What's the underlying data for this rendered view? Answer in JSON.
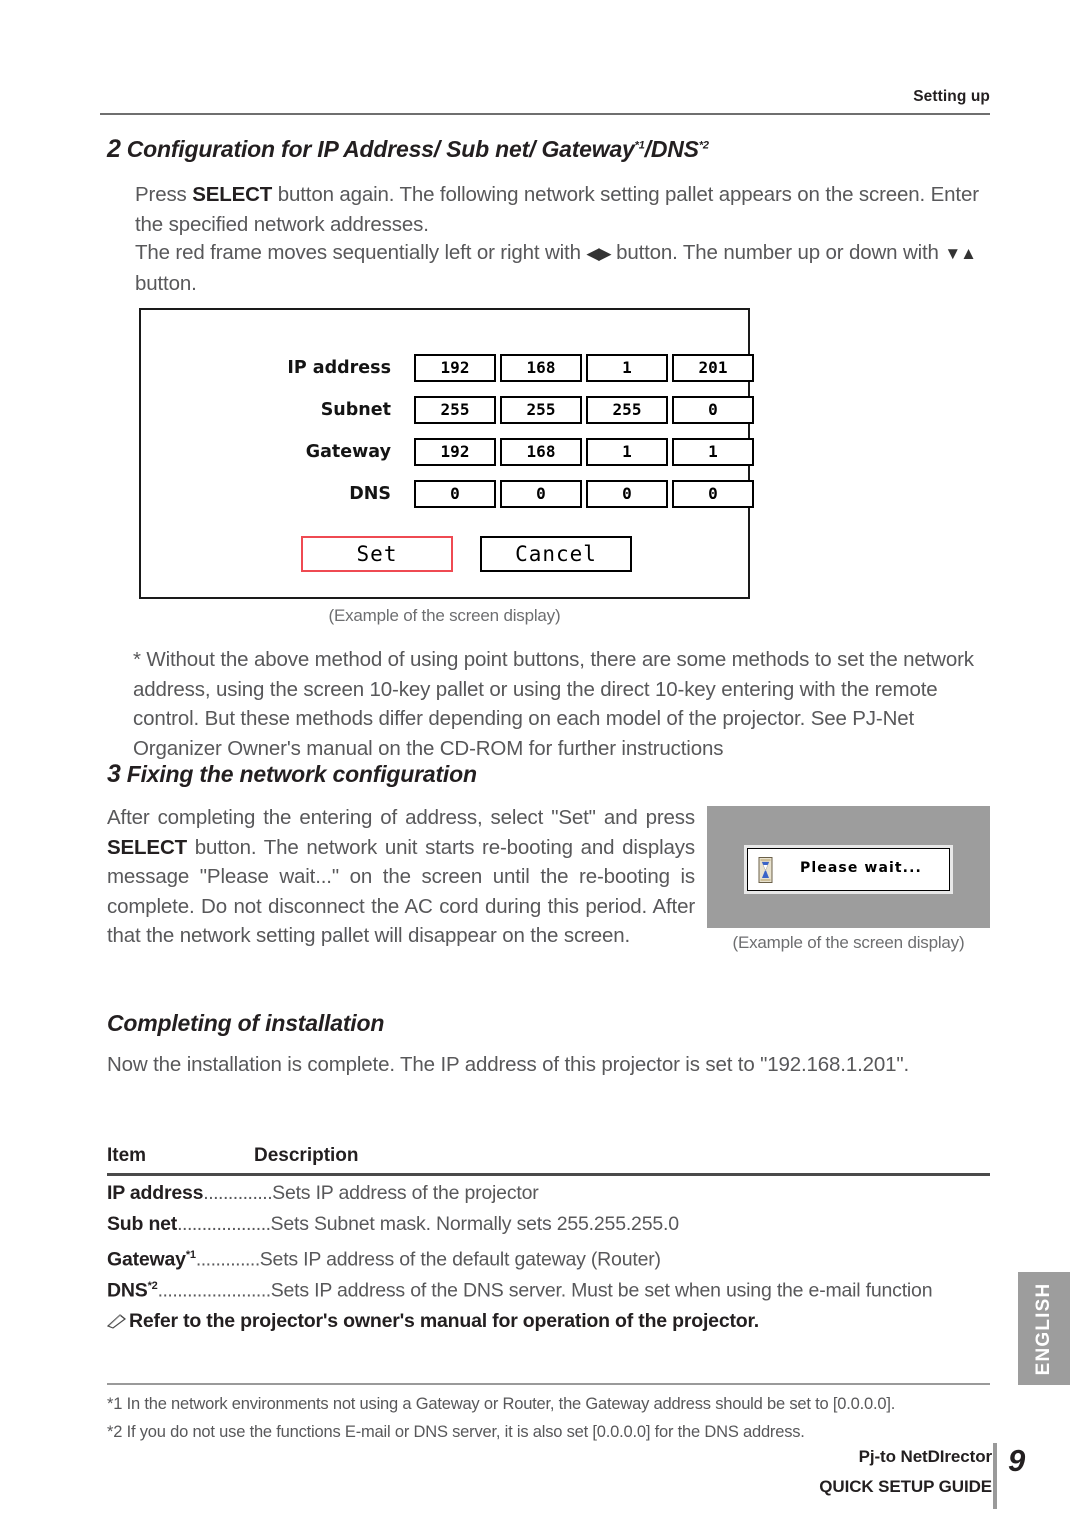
{
  "header": {
    "title": "Setting up"
  },
  "section2": {
    "number": "2",
    "title_main": "Configuration for IP Address/ Sub net/ Gateway",
    "title_sup1": "*1",
    "title_mid": "/DNS",
    "title_sup2": "*2",
    "p1_a": "Press ",
    "p1_bold": "SELECT",
    "p1_b": " button again. The following network setting pallet appears on the screen. Enter the specified network addresses.",
    "p2_a": "The red frame moves  sequentially left or right with ",
    "p2_icons_lr": "◀▶",
    "p2_b": " button. The number up or down with ",
    "p2_icons_ud": "▼▲",
    "p2_c": " button."
  },
  "pallet": {
    "rows": [
      {
        "label": "IP address",
        "values": [
          "192",
          "168",
          "1",
          "201"
        ]
      },
      {
        "label": "Subnet",
        "values": [
          "255",
          "255",
          "255",
          "0"
        ]
      },
      {
        "label": "Gateway",
        "values": [
          "192",
          "168",
          "1",
          "1"
        ]
      },
      {
        "label": "DNS",
        "values": [
          "0",
          "0",
          "0",
          "0"
        ]
      }
    ],
    "set_label": "Set",
    "cancel_label": "Cancel",
    "selected_border_color": "#ef4a52",
    "caption": "(Example of the screen display)"
  },
  "footnote_star": {
    "text": "* Without the above method of using point buttons, there are some methods to set the network address, using the screen 10-key pallet or using the direct 10-key entering with the remote control. But these methods differ depending on each model of the projector. See PJ-Net Organizer Owner's manual on the CD-ROM for further instructions"
  },
  "section3": {
    "number": "3",
    "title": "Fixing the network configuration",
    "p_a": "After completing the entering of address, select \"Set\" and press ",
    "p_bold": "SELECT",
    "p_b": " button. The network unit starts re-booting and displays message \"Please wait...\" on the screen until the re-booting is complete. Do not disconnect the AC cord during this period. After that the network setting pallet will disappear on the screen."
  },
  "please_wait": {
    "message": "Please wait...",
    "icon": "hourglass-icon",
    "screen_color": "#9d9d9d",
    "caption": "(Example of the screen display)"
  },
  "completing": {
    "title": "Completing of installation",
    "body": "Now the installation is complete. The IP address of this projector is set to \"192.168.1.201\"."
  },
  "table": {
    "col_item": "Item",
    "col_description": "Description",
    "rows": [
      {
        "item": "IP address",
        "sup": "",
        "dots": "..............",
        "desc": "Sets IP address of the projector"
      },
      {
        "item": "Sub net",
        "sup": "",
        "dots": "...................",
        "desc": "Sets Subnet mask. Normally sets 255.255.255.0"
      },
      {
        "item": "Gateway",
        "sup": "*1",
        "dots": ".............",
        "desc": "Sets IP address of the default gateway (Router)"
      },
      {
        "item": "DNS",
        "sup": "*2",
        "dots": ".......................",
        "desc": "Sets IP address of the DNS server. Must be set when using the e-mail function"
      }
    ]
  },
  "note": {
    "icon": "pencil-note-icon",
    "text": "Refer to the projector's owner's manual for operation of the projector."
  },
  "footnotes": [
    "*1 In the network environments not using a Gateway or Router, the Gateway address should be set to [0.0.0.0].",
    "*2 If you do not use the functions E-mail or DNS server, it is also set [0.0.0.0] for the DNS address."
  ],
  "side_tab": {
    "label": "ENGLISH"
  },
  "footer": {
    "brand_line1": "Pj-to NetDIrector",
    "brand_line2": "QUICK SETUP GUIDE",
    "page_number": "9"
  }
}
